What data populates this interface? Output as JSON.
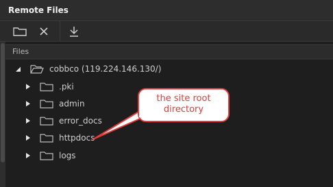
{
  "panel": {
    "title": "Remote Files"
  },
  "toolbar": {
    "buttons": [
      {
        "icon": "folder-icon"
      },
      {
        "icon": "close-icon"
      },
      {
        "icon": "download-icon"
      }
    ]
  },
  "files_header": "Files",
  "tree": {
    "root": {
      "label": "cobbco (119.224.146.130/)",
      "expanded": true
    },
    "children": [
      {
        "label": ".pki"
      },
      {
        "label": "admin"
      },
      {
        "label": "error_docs"
      },
      {
        "label": "httpdocs"
      },
      {
        "label": "logs"
      }
    ]
  },
  "callout": {
    "lines": [
      "the site root",
      "directory"
    ],
    "color": "#e03a3a"
  }
}
